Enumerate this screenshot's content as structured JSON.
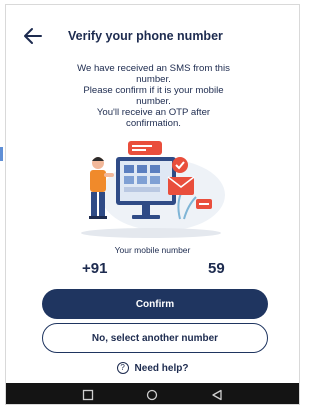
{
  "header": {
    "title": "Verify your phone number",
    "back_icon": "arrow-left-icon"
  },
  "message": {
    "line1": "We have received an SMS from this",
    "line2": "number.",
    "line3": "Please confirm if it is your mobile",
    "line4": "number.",
    "line5": "You'll receive an OTP after",
    "line6": "confirmation."
  },
  "mobile": {
    "label": "Your mobile number",
    "prefix": "+91",
    "suffix": "59"
  },
  "buttons": {
    "confirm": "Confirm",
    "other": "No, select another number"
  },
  "help": {
    "icon": "question-circle-icon",
    "label": "Need help?"
  },
  "navbar": {
    "icons": [
      "square-recent-icon",
      "circle-home-icon",
      "triangle-back-icon"
    ]
  },
  "colors": {
    "primary": "#1f3560",
    "text": "#1d2b4f",
    "accent_red": "#e94e3c",
    "navbar": "#141414"
  }
}
